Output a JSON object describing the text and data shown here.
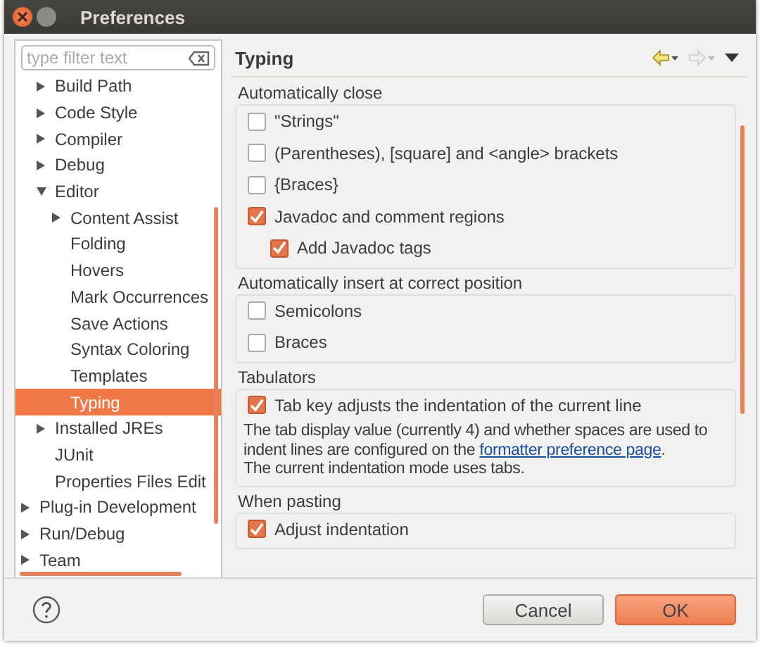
{
  "window": {
    "title": "Preferences"
  },
  "filter": {
    "placeholder": "type filter text"
  },
  "tree": {
    "nested_items": [
      {
        "label": "Build Path",
        "expanded": false,
        "selected": false
      },
      {
        "label": "Code Style",
        "expanded": false,
        "selected": false
      },
      {
        "label": "Compiler",
        "expanded": false,
        "selected": false
      },
      {
        "label": "Debug",
        "expanded": false,
        "selected": false
      },
      {
        "label": "Editor",
        "expanded": true,
        "selected": false,
        "children": [
          {
            "label": "Content Assist",
            "expanded": false,
            "selected": false
          },
          {
            "label": "Folding",
            "selected": false
          },
          {
            "label": "Hovers",
            "selected": false
          },
          {
            "label": "Mark Occurrences",
            "selected": false
          },
          {
            "label": "Save Actions",
            "selected": false
          },
          {
            "label": "Syntax Coloring",
            "selected": false
          },
          {
            "label": "Templates",
            "selected": false
          },
          {
            "label": "Typing",
            "selected": true
          }
        ]
      },
      {
        "label": "Installed JREs",
        "expanded": false,
        "selected": false
      },
      {
        "label": "JUnit",
        "selected": false
      },
      {
        "label": "Properties Files Edit",
        "selected": false
      }
    ],
    "top_items": [
      {
        "label": "Plug-in Development",
        "expanded": false,
        "selected": false
      },
      {
        "label": "Run/Debug",
        "expanded": false,
        "selected": false
      },
      {
        "label": "Team",
        "expanded": false,
        "selected": false
      }
    ]
  },
  "page": {
    "title": "Typing",
    "groups": [
      {
        "title": "Automatically close",
        "options": [
          {
            "label": "\"Strings\"",
            "checked": false
          },
          {
            "label": "(Parentheses), [square] and <angle> brackets",
            "checked": false
          },
          {
            "label": "{Braces}",
            "checked": false
          },
          {
            "label": "Javadoc and comment regions",
            "checked": true,
            "children": [
              {
                "label": "Add Javadoc tags",
                "checked": true
              }
            ]
          }
        ]
      },
      {
        "title": "Automatically insert at correct position",
        "options": [
          {
            "label": "Semicolons",
            "checked": false
          },
          {
            "label": "Braces",
            "checked": false
          }
        ]
      },
      {
        "title": "Tabulators",
        "options": [
          {
            "label": "Tab key adjusts the indentation of the current line",
            "checked": true
          }
        ],
        "note": {
          "before": "The tab display value (currently 4) and whether spaces are used to indent lines are configured on the ",
          "link": "formatter preference page",
          "after": ".",
          "last_line": "The current indentation mode uses tabs."
        }
      },
      {
        "title": "When pasting",
        "options": [
          {
            "label": "Adjust indentation",
            "checked": true
          }
        ]
      }
    ]
  },
  "buttons": [
    {
      "label": "Cancel",
      "kind": "secondary"
    },
    {
      "label": "OK",
      "kind": "primary"
    }
  ]
}
